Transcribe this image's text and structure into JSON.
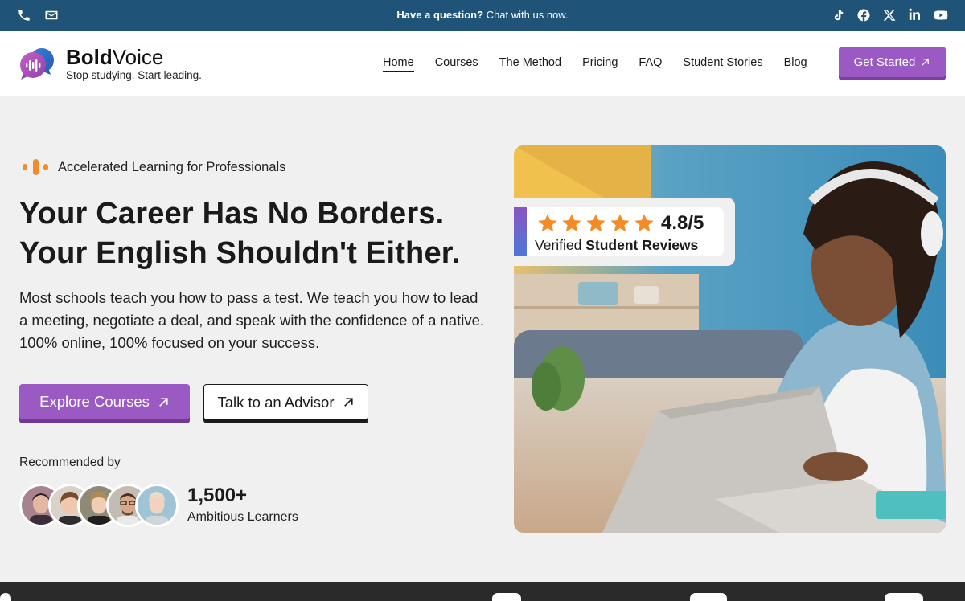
{
  "topbar": {
    "question_bold": "Have a question?",
    "question_rest": " Chat with us now.",
    "left_icons": [
      "phone-icon",
      "mail-icon"
    ],
    "social_icons": [
      "tiktok-icon",
      "facebook-icon",
      "x-icon",
      "linkedin-icon",
      "youtube-icon"
    ]
  },
  "brand": {
    "name_bold": "Bold",
    "name_rest": "Voice",
    "tagline": "Stop studying. Start leading."
  },
  "nav": {
    "items": [
      {
        "label": "Home",
        "active": true
      },
      {
        "label": "Courses"
      },
      {
        "label": "The Method"
      },
      {
        "label": "Pricing"
      },
      {
        "label": "FAQ"
      },
      {
        "label": "Student Stories"
      },
      {
        "label": "Blog"
      }
    ],
    "cta_label": "Get Started"
  },
  "hero": {
    "eyebrow": "Accelerated Learning for Professionals",
    "headline_line1": "Your Career Has No Borders.",
    "headline_line2": "Your English Shouldn't Either.",
    "lead": "Most schools teach you how to pass a test. We teach you how to lead a meeting, negotiate a deal, and speak with the confidence of a native. 100% online, 100% focused on your success.",
    "primary_cta": "Explore Courses",
    "secondary_cta": "Talk to an Advisor",
    "recommended_label": "Recommended by",
    "learner_count": "1,500+",
    "learner_label": "Ambitious Learners"
  },
  "review": {
    "rating": "4.8/5",
    "stars": 5,
    "label_prefix": "Verified ",
    "label_bold": "Student Reviews"
  },
  "colors": {
    "topbar": "#1f5478",
    "accent": "#9b59c3",
    "star": "#f28c28"
  }
}
